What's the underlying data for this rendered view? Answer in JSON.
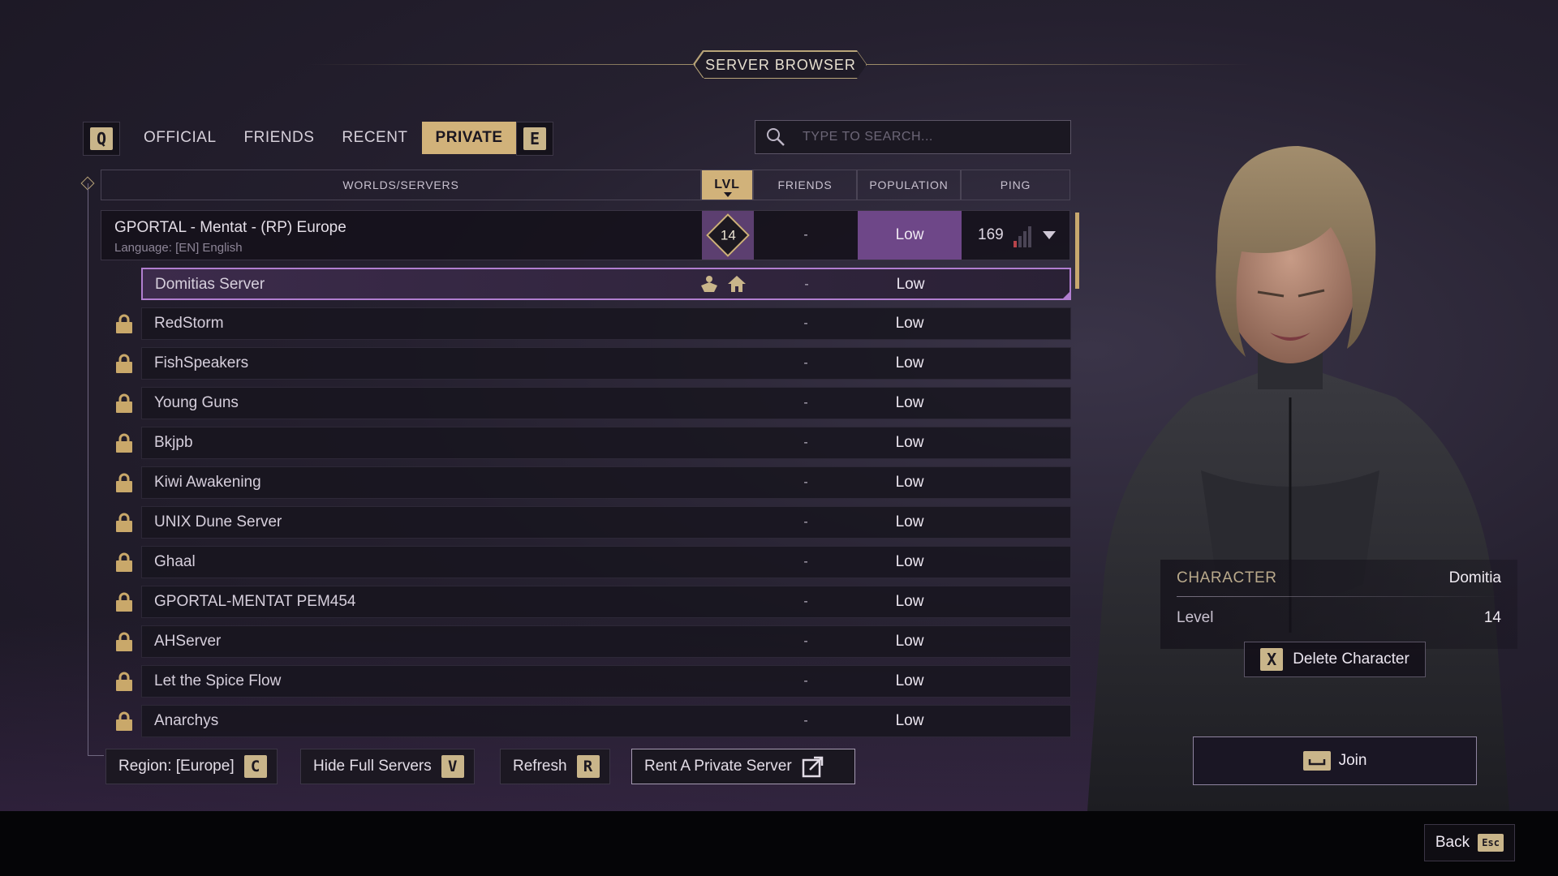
{
  "title": "SERVER BROWSER",
  "tabs": {
    "prev_key": "Q",
    "next_key": "E",
    "items": [
      "OFFICIAL",
      "FRIENDS",
      "RECENT",
      "PRIVATE"
    ],
    "active": "PRIVATE"
  },
  "search": {
    "placeholder": "TYPE TO SEARCH..."
  },
  "columns": {
    "worlds": "WORLDS/SERVERS",
    "lvl": "LVL",
    "friends": "FRIENDS",
    "population": "POPULATION",
    "ping": "PING"
  },
  "world": {
    "name": "GPORTAL - Mentat - (RP) Europe",
    "language": "Language: [EN] English",
    "level": "14",
    "friends": "-",
    "population": "Low",
    "ping": "169"
  },
  "servers": [
    {
      "name": "Domitias Server",
      "friends": "-",
      "population": "Low",
      "locked": false,
      "selected": true
    },
    {
      "name": "RedStorm",
      "friends": "-",
      "population": "Low",
      "locked": true
    },
    {
      "name": "FishSpeakers",
      "friends": "-",
      "population": "Low",
      "locked": true
    },
    {
      "name": "Young Guns",
      "friends": "-",
      "population": "Low",
      "locked": true
    },
    {
      "name": "Bkjpb",
      "friends": "-",
      "population": "Low",
      "locked": true
    },
    {
      "name": "Kiwi Awakening",
      "friends": "-",
      "population": "Low",
      "locked": true
    },
    {
      "name": "UNIX Dune Server",
      "friends": "-",
      "population": "Low",
      "locked": true
    },
    {
      "name": "Ghaal",
      "friends": "-",
      "population": "Low",
      "locked": true
    },
    {
      "name": "GPORTAL-MENTAT PEM454",
      "friends": "-",
      "population": "Low",
      "locked": true
    },
    {
      "name": "AHServer",
      "friends": "-",
      "population": "Low",
      "locked": true
    },
    {
      "name": "Let the Spice Flow",
      "friends": "-",
      "population": "Low",
      "locked": true
    },
    {
      "name": "Anarchys",
      "friends": "-",
      "population": "Low",
      "locked": true
    }
  ],
  "buttons": {
    "region": {
      "label": "Region: [Europe]",
      "key": "C"
    },
    "hide_full": {
      "label": "Hide Full Servers",
      "key": "V"
    },
    "refresh": {
      "label": "Refresh",
      "key": "R"
    },
    "rent": {
      "label": "Rent A Private Server"
    }
  },
  "character": {
    "label": "CHARACTER",
    "name": "Domitia",
    "level_label": "Level",
    "level": "14",
    "delete_key": "X",
    "delete_label": "Delete Character",
    "join_label": "Join"
  },
  "back": {
    "label": "Back",
    "key": "Esc"
  },
  "colors": {
    "accent_gold": "#d1b27a",
    "accent_purple": "#6e4788",
    "selected_border": "#b17ed0"
  }
}
